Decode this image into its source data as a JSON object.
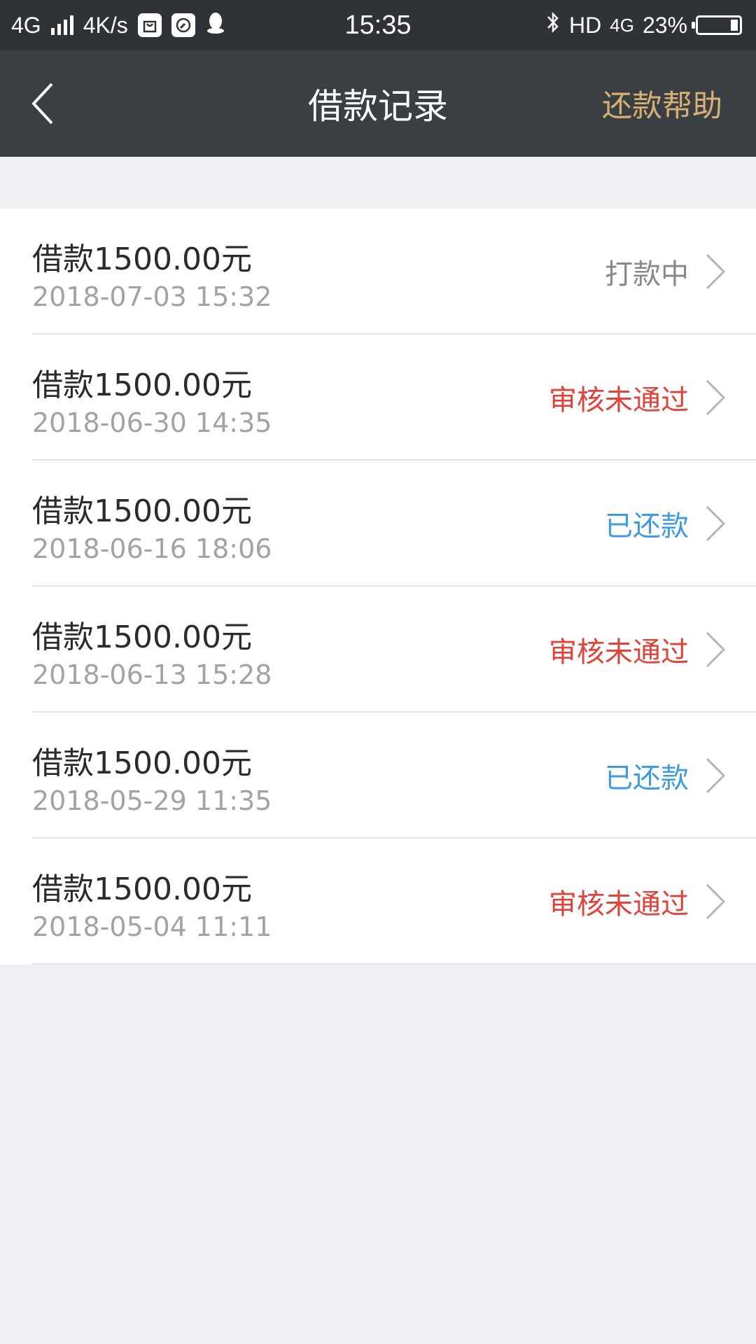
{
  "status_bar": {
    "network": "4G",
    "speed": "4K/s",
    "time": "15:35",
    "hd": "HD",
    "data_type": "4G",
    "battery": "23%",
    "icons": [
      "signal-icon",
      "bag-icon",
      "compass-icon",
      "qq-penguin-icon",
      "bluetooth-icon",
      "battery-icon"
    ]
  },
  "nav": {
    "title": "借款记录",
    "help_label": "还款帮助",
    "back_icon": "back-chevron-icon"
  },
  "colors": {
    "nav_bg": "#3a3f44",
    "status_bg": "#2f3337",
    "accent_gold": "#d6b074",
    "status_pending": "#888888",
    "status_rejected": "#e0433a",
    "status_repaid": "#3d9be3"
  },
  "records": [
    {
      "amount": "借款1500.00元",
      "date": "2018-07-03 15:32",
      "status": "打款中",
      "status_color": "#888888"
    },
    {
      "amount": "借款1500.00元",
      "date": "2018-06-30 14:35",
      "status": "审核未通过",
      "status_color": "#e0433a"
    },
    {
      "amount": "借款1500.00元",
      "date": "2018-06-16 18:06",
      "status": "已还款",
      "status_color": "#3d9be3"
    },
    {
      "amount": "借款1500.00元",
      "date": "2018-06-13 15:28",
      "status": "审核未通过",
      "status_color": "#e0433a"
    },
    {
      "amount": "借款1500.00元",
      "date": "2018-05-29 11:35",
      "status": "已还款",
      "status_color": "#3d9be3"
    },
    {
      "amount": "借款1500.00元",
      "date": "2018-05-04 11:11",
      "status": "审核未通过",
      "status_color": "#e0433a"
    }
  ]
}
